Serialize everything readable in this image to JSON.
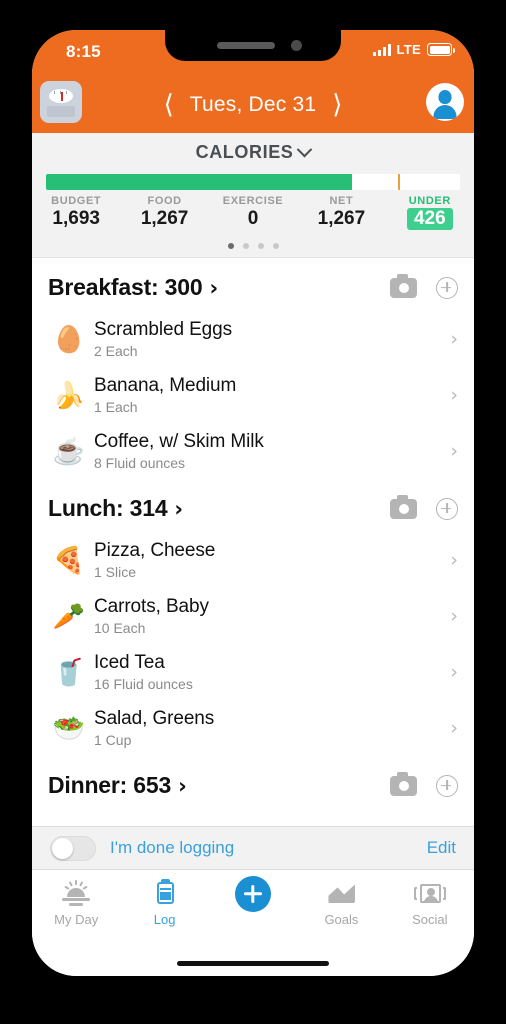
{
  "status_bar": {
    "time": "8:15",
    "network": "LTE",
    "battery_icon": "battery-full-icon"
  },
  "nav": {
    "scale_icon": "bathroom-scale-icon",
    "prev_icon": "chevron-left-icon",
    "date": "Tues, Dec 31",
    "next_icon": "chevron-right-icon",
    "avatar_icon": "user-avatar-icon"
  },
  "summary": {
    "title": "CALORIES",
    "caret_icon": "chevron-down-icon",
    "progress_percent": 74,
    "marker_percent": 85,
    "fill_color": "#27BE76",
    "marker_color": "#E8A33D",
    "badge_color": "#3ECF8E",
    "stats": [
      {
        "label": "BUDGET",
        "value": "1,693"
      },
      {
        "label": "FOOD",
        "value": "1,267"
      },
      {
        "label": "EXERCISE",
        "value": "0"
      },
      {
        "label": "NET",
        "value": "1,267"
      }
    ],
    "under": {
      "label": "UNDER",
      "value": "426"
    },
    "page_dots": {
      "count": 4,
      "active": 0
    }
  },
  "meals": [
    {
      "title": "Breakfast: 300",
      "arrow_icon": "chevron-right-icon",
      "camera_icon": "camera-icon",
      "add_icon": "plus-circle-icon",
      "items": [
        {
          "emoji": "🥚",
          "icon_name": "egg-icon",
          "name": "Scrambled Eggs",
          "amount": "2 Each"
        },
        {
          "emoji": "🍌",
          "icon_name": "banana-icon",
          "name": "Banana, Medium",
          "amount": "1 Each"
        },
        {
          "emoji": "☕",
          "icon_name": "coffee-icon",
          "name": "Coffee, w/ Skim Milk",
          "amount": "8 Fluid ounces"
        }
      ]
    },
    {
      "title": "Lunch: 314",
      "arrow_icon": "chevron-right-icon",
      "camera_icon": "camera-icon",
      "add_icon": "plus-circle-icon",
      "items": [
        {
          "emoji": "🍕",
          "icon_name": "pizza-icon",
          "name": "Pizza, Cheese",
          "amount": "1 Slice"
        },
        {
          "emoji": "🥕",
          "icon_name": "carrot-icon",
          "name": "Carrots, Baby",
          "amount": "10 Each"
        },
        {
          "emoji": "🥤",
          "icon_name": "iced-tea-icon",
          "name": "Iced Tea",
          "amount": "16 Fluid ounces"
        },
        {
          "emoji": "🥗",
          "icon_name": "salad-icon",
          "name": "Salad, Greens",
          "amount": "1 Cup"
        }
      ]
    },
    {
      "title": "Dinner: 653",
      "arrow_icon": "chevron-right-icon",
      "camera_icon": "camera-icon",
      "add_icon": "plus-circle-icon",
      "items": []
    }
  ],
  "done_bar": {
    "toggle_state": "off",
    "label": "I'm done logging",
    "edit_label": "Edit",
    "link_color": "#39A1DE"
  },
  "tabs": [
    {
      "label": "My Day",
      "icon": "sunrise-icon",
      "active": false
    },
    {
      "label": "Log",
      "icon": "clipboard-icon",
      "active": true
    },
    {
      "label": "",
      "icon": "plus-button-icon",
      "active": false
    },
    {
      "label": "Goals",
      "icon": "mountain-icon",
      "active": false
    },
    {
      "label": "Social",
      "icon": "people-icon",
      "active": false
    }
  ]
}
